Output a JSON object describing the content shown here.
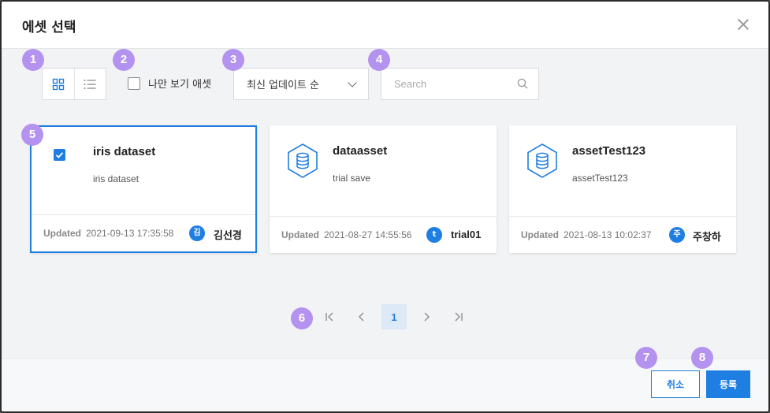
{
  "dialog": {
    "title": "에셋 선택"
  },
  "toolbar": {
    "mine_only_label": "나만 보기 애셋",
    "mine_only_checked": false,
    "sort_selected": "최신 업데이트 순",
    "search_placeholder": "Search",
    "view_mode": "grid"
  },
  "badges": [
    "1",
    "2",
    "3",
    "4",
    "5",
    "6",
    "7",
    "8"
  ],
  "cards": [
    {
      "title": "iris dataset",
      "desc": "iris dataset",
      "updated_label": "Updated",
      "updated": "2021-09-13 17:35:58",
      "avatar": "김",
      "user": "김선경",
      "selected": true
    },
    {
      "title": "dataasset",
      "desc": "trial save",
      "updated_label": "Updated",
      "updated": "2021-08-27 14:55:56",
      "avatar": "t",
      "user": "trial01",
      "selected": false
    },
    {
      "title": "assetTest123",
      "desc": "assetTest123",
      "updated_label": "Updated",
      "updated": "2021-08-13 10:02:37",
      "avatar": "주",
      "user": "주창하",
      "selected": false
    }
  ],
  "pagination": {
    "current": "1"
  },
  "buttons": {
    "cancel": "취소",
    "submit": "등록"
  },
  "colors": {
    "accent": "#1f7ee1",
    "badge": "#b493f0"
  }
}
